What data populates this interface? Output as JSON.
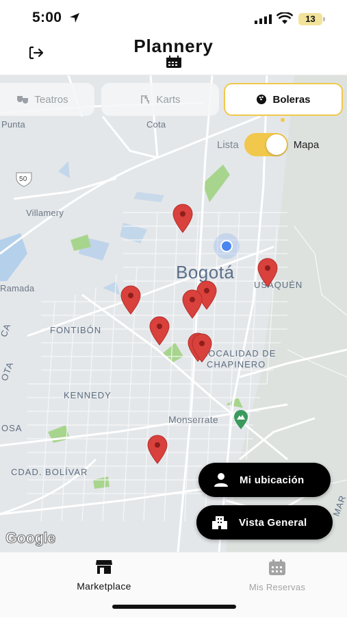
{
  "status": {
    "time": "5:00",
    "battery": "13"
  },
  "header": {
    "title": "Plannery"
  },
  "tabs": [
    {
      "label": "Teatros",
      "icon": "theater-icon",
      "active": false
    },
    {
      "label": "Karts",
      "icon": "kart-icon",
      "active": false
    },
    {
      "label": "Boleras",
      "icon": "bowling-icon",
      "active": true
    }
  ],
  "toggle": {
    "left_label": "Lista",
    "right_label": "Mapa",
    "selected": "Mapa"
  },
  "map": {
    "labels": {
      "punta": "Punta",
      "cota": "Cota",
      "route": "50",
      "villamery": "Villamery",
      "ramada": "Ramada",
      "bogota": "Bogotá",
      "usaquen": "USAQUÉN",
      "fontibon": "FONTIBÓN",
      "chapinero_1": "LOCALIDAD DE",
      "chapinero_2": "CHAPINERO",
      "kennedy": "KENNEDY",
      "monserrate": "Monserrate",
      "cdad_bolivar": "CDAD. BOLÍVAR",
      "bosa": "OSA",
      "edge_ca": "CA",
      "edge_ota": "OTA",
      "edge_mar": "MAR"
    },
    "marker_count": 9,
    "attribution": "Google"
  },
  "buttons": {
    "my_location": "Mi ubicación",
    "overview": "Vista General"
  },
  "bottom_nav": [
    {
      "label": "Marketplace",
      "icon": "store-icon",
      "active": true
    },
    {
      "label": "Mis Reservas",
      "icon": "calendar-icon",
      "active": false
    }
  ],
  "colors": {
    "accent": "#f1c84b",
    "marker": "#d9413c",
    "user_location": "#4a86f0"
  }
}
